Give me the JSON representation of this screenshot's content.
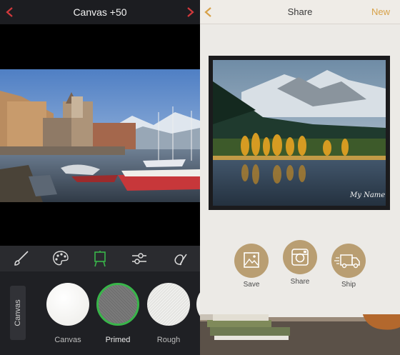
{
  "left_screen": {
    "title": "Canvas +50",
    "toolbar": [
      "brush-icon",
      "palette-icon",
      "canvas-easel-icon",
      "sliders-icon",
      "signature-icon"
    ],
    "category_tab": "Canvas",
    "textures": [
      {
        "label": "Canvas",
        "selected": false
      },
      {
        "label": "Primed",
        "selected": true
      },
      {
        "label": "Rough",
        "selected": false
      }
    ],
    "colors": {
      "accent_red": "#d2393c",
      "selected_green": "#39b54a"
    }
  },
  "right_screen": {
    "title": "Share",
    "new_label": "New",
    "signature": "My Name",
    "actions": [
      {
        "label": "Save",
        "icon": "image-icon"
      },
      {
        "label": "Share",
        "icon": "instagram-icon"
      },
      {
        "label": "Ship",
        "icon": "truck-icon"
      }
    ],
    "colors": {
      "accent_gold": "#d7a148",
      "action_bg": "#b99e72"
    }
  }
}
